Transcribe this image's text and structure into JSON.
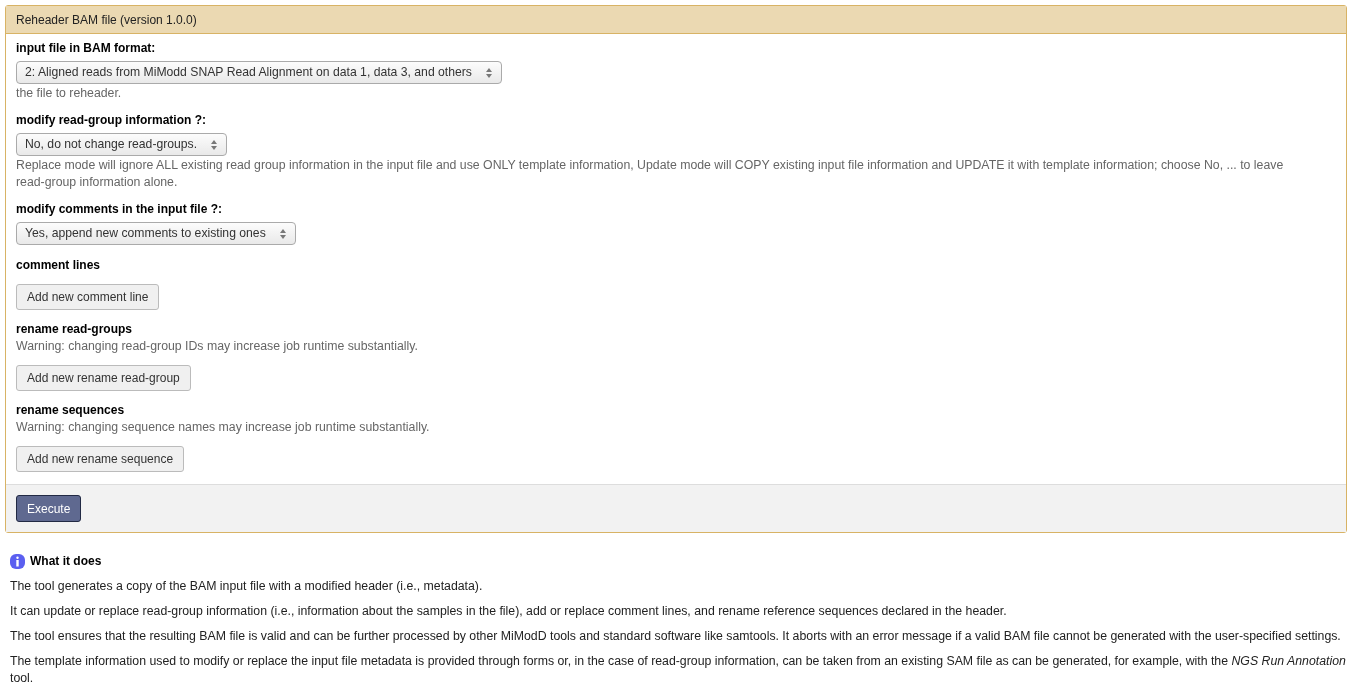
{
  "tool_form": {
    "title": "Reheader BAM file (version 1.0.0)",
    "fields": [
      {
        "kind": "select",
        "label": "input file in BAM format:",
        "value": "2: Aligned reads from MiModd SNAP Read Alignment on data 1, data 3, and others",
        "help": "the file to reheader."
      },
      {
        "kind": "select",
        "label": "modify read-group information ?:",
        "value": "No, do not change read-groups.",
        "help": "Replace mode will ignore ALL existing read group information in the input file and use ONLY template information, Update mode will COPY existing input file information and UPDATE it with template information; choose No, ... to leave read-group information alone."
      },
      {
        "kind": "select",
        "label": "modify comments in the input file ?:",
        "value": "Yes, append new comments to existing ones"
      },
      {
        "kind": "repeat",
        "label": "comment lines",
        "button": "Add new comment line"
      },
      {
        "kind": "repeat",
        "label": "rename read-groups",
        "help": "Warning: changing read-group IDs may increase job runtime substantially.",
        "button": "Add new rename read-group"
      },
      {
        "kind": "repeat",
        "label": "rename sequences",
        "help": "Warning: changing sequence names may increase job runtime substantially.",
        "button": "Add new rename sequence"
      }
    ],
    "execute_button": "Execute"
  },
  "help": {
    "heading": "What it does",
    "paragraphs": [
      "The tool generates a copy of the BAM input file with a modified header (i.e., metadata).",
      "It can update or replace read-group information (i.e., information about the samples in the file), add or replace comment lines, and rename reference sequences declared in the header.",
      "The tool ensures that the resulting BAM file is valid and can be further processed by other MiModD tools and standard software like samtools. It aborts with an error message if a valid BAM file cannot be generated with the user-specified settings.",
      "The template information used to modify or replace the input file metadata is provided through forms or, in the case of read-group information, can be taken from an existing SAM file as can be generated, for example, with the *NGS Run Annotation* tool."
    ]
  }
}
